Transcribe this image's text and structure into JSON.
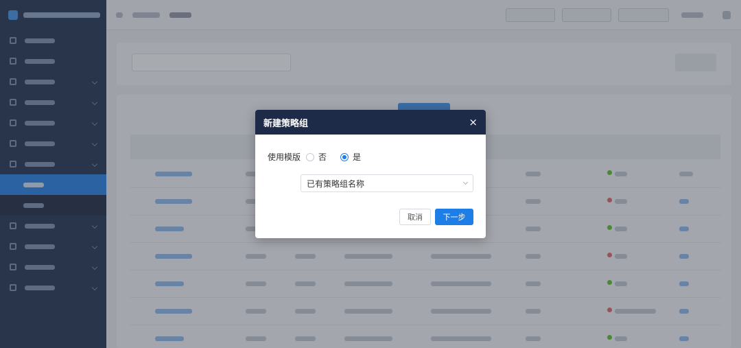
{
  "dialog": {
    "title": "新建策略组",
    "close_glyph": "×",
    "template_label": "使用模版",
    "options": [
      {
        "label": "否",
        "selected": false
      },
      {
        "label": "是",
        "selected": true
      }
    ],
    "select_value": "已有策略组名称",
    "cancel_label": "取消",
    "next_label": "下一步"
  },
  "colors": {
    "accent": "#1e7ee8",
    "header_bg": "#1d2b48",
    "sidebar_bg": "#1b2a47"
  }
}
